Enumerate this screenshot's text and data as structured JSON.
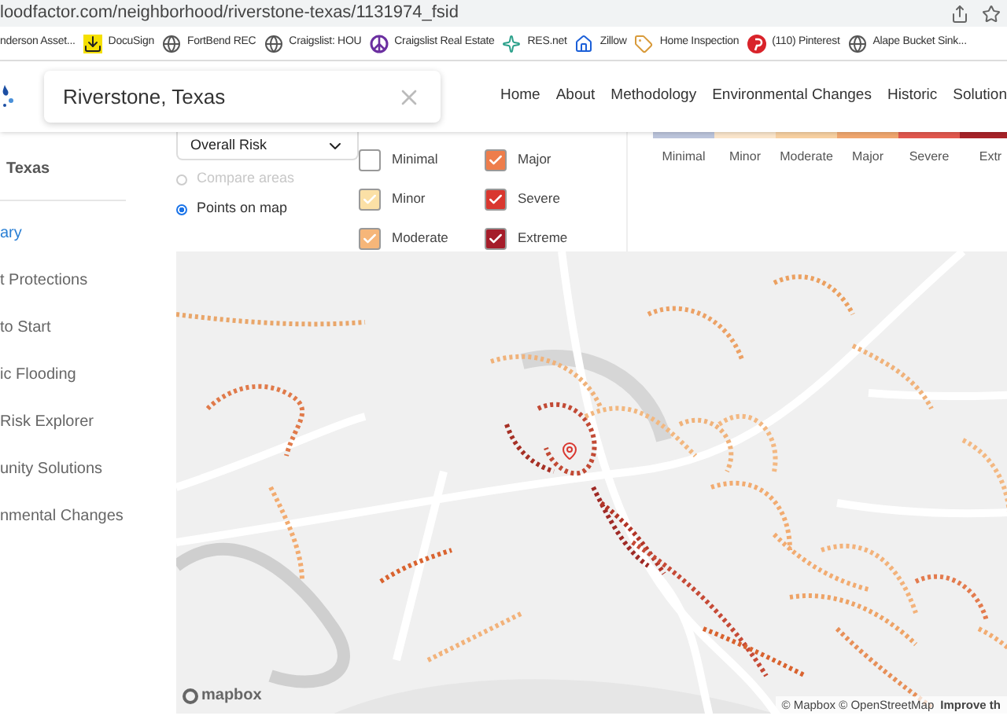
{
  "browser": {
    "url": "loodfactor.com/neighborhood/riverstone-texas/1131974_fsid",
    "bookmarks": [
      {
        "label": "nderson Asset...",
        "kind": "none"
      },
      {
        "label": "DocuSign",
        "kind": "download"
      },
      {
        "label": "FortBend REC",
        "kind": "globe"
      },
      {
        "label": "Craigslist: HOU",
        "kind": "globe"
      },
      {
        "label": "Craigslist Real Estate",
        "kind": "peace"
      },
      {
        "label": "RES.net",
        "kind": "star"
      },
      {
        "label": "Zillow",
        "kind": "house"
      },
      {
        "label": "Home Inspection",
        "kind": "tag"
      },
      {
        "label": "(110) Pinterest",
        "kind": "pin"
      },
      {
        "label": "Alape Bucket Sink...",
        "kind": "globe"
      }
    ]
  },
  "header": {
    "search": {
      "value": "Riverstone, Texas"
    },
    "nav": [
      "Home",
      "About",
      "Methodology",
      "Environmental Changes",
      "Historic",
      "Solution"
    ]
  },
  "sidebar": {
    "title": "Texas",
    "items": [
      {
        "label": "ary",
        "selected": true
      },
      {
        "label": "t Protections",
        "selected": false
      },
      {
        "label": "to Start",
        "selected": false
      },
      {
        "label": "ic Flooding",
        "selected": false
      },
      {
        "label": "Risk Explorer",
        "selected": false
      },
      {
        "label": "unity Solutions",
        "selected": false
      },
      {
        "label": "nmental Changes",
        "selected": false
      }
    ]
  },
  "filters": {
    "dropdown": "Overall Risk",
    "options": [
      {
        "label": "Compare areas",
        "selected": false,
        "disabled": true
      },
      {
        "label": "Points on map",
        "selected": true,
        "disabled": false
      }
    ],
    "risk_levels": [
      {
        "label": "Minimal",
        "checked": false,
        "color": "#ffffff"
      },
      {
        "label": "Major",
        "checked": true,
        "color": "#ee7d4b"
      },
      {
        "label": "Minor",
        "checked": true,
        "color": "#fbe0a6"
      },
      {
        "label": "Severe",
        "checked": true,
        "color": "#d9372f"
      },
      {
        "label": "Moderate",
        "checked": true,
        "color": "#f6b679"
      },
      {
        "label": "Extreme",
        "checked": true,
        "color": "#a51d2a"
      }
    ]
  },
  "legend": [
    {
      "label": "Minimal",
      "color": "#bcc5dc"
    },
    {
      "label": "Minor",
      "color": "#fbe6cc"
    },
    {
      "label": "Moderate",
      "color": "#f8d1a2"
    },
    {
      "label": "Major",
      "color": "#f1a76f"
    },
    {
      "label": "Severe",
      "color": "#e2584e"
    },
    {
      "label": "Extr",
      "color": "#a82329"
    }
  ],
  "map": {
    "logo": "mapbox",
    "attribution": "© Mapbox © OpenStreetMap",
    "improve_link": "Improve th"
  }
}
